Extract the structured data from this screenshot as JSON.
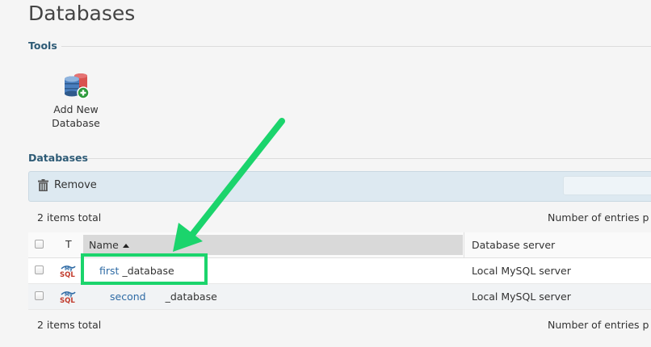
{
  "page": {
    "title": "Databases"
  },
  "tools": {
    "heading": "Tools",
    "items": [
      {
        "label_line1": "Add New",
        "label_line2": "Database",
        "icon": "add-database-icon"
      }
    ]
  },
  "databases": {
    "heading": "Databases",
    "toolbar": {
      "remove_label": "Remove",
      "search_value": "",
      "search_placeholder": ""
    },
    "items_total_top": "2 items total",
    "entries_label_top": "Number of entries p",
    "items_total_bottom": "2 items total",
    "entries_label_bottom": "Number of entries p",
    "columns": {
      "type": "T",
      "name": "Name",
      "server": "Database server"
    },
    "rows": [
      {
        "name_part1": "first",
        "name_part2": "_database",
        "server": "Local MySQL server",
        "icon": "mysql-icon"
      },
      {
        "name_part1": "second",
        "name_part2": "_database",
        "server": "Local MySQL server",
        "icon": "mysql-icon"
      }
    ]
  },
  "annotation": {
    "color": "#1bd46c",
    "target_row": 0
  },
  "colors": {
    "section_title": "#2e5b76",
    "link": "#2f6ba5",
    "toolbar_bg": "#dde9f1",
    "name_header_bg": "#d9d9d9"
  }
}
